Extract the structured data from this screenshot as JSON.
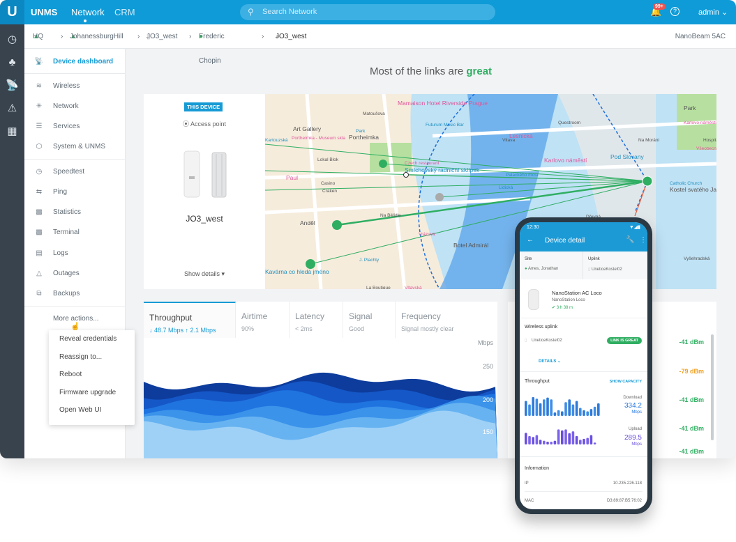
{
  "topbar": {
    "brand": "UNMS",
    "nav": [
      "Network",
      "CRM"
    ],
    "search_placeholder": "Search Network",
    "notifications": "99+",
    "user": "admin"
  },
  "breadcrumb": {
    "items": [
      "HQ",
      "JohanessburgHill",
      "JO3_west",
      "Frederic Chopin",
      "JO3_west"
    ],
    "device_model": "NanoBeam 5AC"
  },
  "sidebar": {
    "items": [
      "Device dashboard",
      "Wireless",
      "Network",
      "Services",
      "System & UNMS",
      "Speedtest",
      "Ping",
      "Statistics",
      "Terminal",
      "Logs",
      "Outages",
      "Backups"
    ],
    "more": "More actions..."
  },
  "more_menu": [
    "Reveal credentials",
    "Reassign to...",
    "Reboot",
    "Firmware upgrade",
    "Open Web UI"
  ],
  "headline": {
    "prefix": "Most of the links are ",
    "status": "great"
  },
  "device": {
    "badge": "THIS DEVICE",
    "mode": "Access point",
    "name": "JO3_west",
    "show_details": "Show details"
  },
  "map_labels": [
    "Mamaison Hotel Riverside Prague",
    "Futurum Music Bar",
    "Matoušova",
    "Art Gallery",
    "Portheimka - Museum skla",
    "Park",
    "Portheimka",
    "Lokal Blok",
    "Czech restaurant",
    "Smíchovský radniční sklípek",
    "Casino",
    "Craken",
    "Paul",
    "Lidická",
    "Na Bělidle",
    "Anděl",
    "Vrázova",
    "J. Plachty",
    "Botel Admirál",
    "La Boutique",
    "Vltavská",
    "Kavárna co hledá jméno",
    "Questroom",
    "Vltava",
    "Karlovo náměstí",
    "Palackého most",
    "Na Moráni",
    "Park",
    "Karlovo náměstí",
    "Catholic Church",
    "Kostel svatého Jana Nepomuckého",
    "Hospital",
    "Všeobecná fakultní nemocnice v Praze",
    "Pod Slovany",
    "Dřevná",
    "Vyšehradská",
    "Lesnická",
    "Kartouzská"
  ],
  "tabs": [
    {
      "title": "Throughput",
      "sub": "↓ 48.7 Mbps   ↑ 2.1 Mbps"
    },
    {
      "title": "Airtime",
      "sub": "90%"
    },
    {
      "title": "Latency",
      "sub": "< 2ms"
    },
    {
      "title": "Signal",
      "sub": "Good"
    },
    {
      "title": "Frequency",
      "sub": "Signal mostly clear"
    }
  ],
  "chart": {
    "unit": "Mbps",
    "ticks": [
      "250",
      "200",
      "150"
    ],
    "colors": [
      "#0d3c9c",
      "#1557c7",
      "#1f74e0",
      "#3b93ea",
      "#67b3f1",
      "#9fd1f7"
    ]
  },
  "signals": [
    {
      "v": "-41 dBm",
      "c": "#2fae62"
    },
    {
      "v": "-79 dBm",
      "c": "#f0a020"
    },
    {
      "v": "-41 dBm",
      "c": "#2fae62"
    },
    {
      "v": "-41 dBm",
      "c": "#2fae62"
    },
    {
      "v": "-41 dBm",
      "c": "#2fae62"
    }
  ],
  "phone": {
    "time": "12:30",
    "title": "Device detail",
    "site_label": "Site",
    "site": "Ames, Jonathan",
    "uplink_label": "Uplink",
    "uplink": "UneticeKostel02",
    "device_name": "NanoStation AC Loco",
    "device_model": "NanoStation Loco",
    "uptime": "3 h 38 m",
    "wireless_uplink": "Wireless uplink",
    "wu_device": "UneticeKostel02",
    "link_status": "LINK IS GREAT",
    "details": "DETAILS",
    "throughput": "Throughput",
    "show_capacity": "SHOW CAPACITY",
    "download_label": "Download",
    "download": "334.2",
    "download_unit": "Mbps",
    "upload_label": "Upload",
    "upload": "289.5",
    "upload_unit": "Mbps",
    "info": "Information",
    "ip_label": "IP",
    "ip": "10.235.226.118",
    "mac_label": "MAC",
    "mac": "D3:89:87:B5:76:02",
    "download_bars": [
      0.65,
      0.5,
      0.82,
      0.75,
      0.55,
      0.72,
      0.8,
      0.72,
      0.15,
      0.25,
      0.2,
      0.6,
      0.72,
      0.5,
      0.65,
      0.35,
      0.25,
      0.2,
      0.3,
      0.4,
      0.55
    ],
    "upload_bars": [
      0.62,
      0.45,
      0.4,
      0.5,
      0.25,
      0.2,
      0.15,
      0.15,
      0.2,
      0.8,
      0.75,
      0.8,
      0.6,
      0.7,
      0.45,
      0.25,
      0.3,
      0.35,
      0.5,
      0.1
    ]
  }
}
